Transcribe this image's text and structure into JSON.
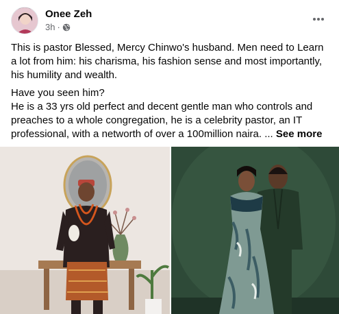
{
  "post": {
    "author": "Onee Zeh",
    "time": "3h",
    "separator": "·",
    "paragraphs": [
      "This is pastor Blessed, Mercy Chinwo's husband.  Men need to Learn  a lot from him: his charisma, his fashion sense  and  most importantly, his humility and wealth.",
      "Have you seen him?"
    ],
    "last_paragraph": "He is a 33 yrs old perfect and decent gentle man who  controls and preaches to a whole congregation, he is a celebrity pastor, an IT professional, with a networth of  over a 100million naira. ...",
    "see_more": "See more"
  },
  "icons": {
    "avatar": "profile-photo",
    "privacy": "globe-icon",
    "options": "more-options-icon"
  },
  "photos": [
    {
      "description_name": "man-in-traditional-attire-photo"
    },
    {
      "description_name": "couple-green-backdrop-photo"
    }
  ],
  "colors": {
    "text": "#050505",
    "secondary_text": "#65676b",
    "background": "#ffffff"
  }
}
